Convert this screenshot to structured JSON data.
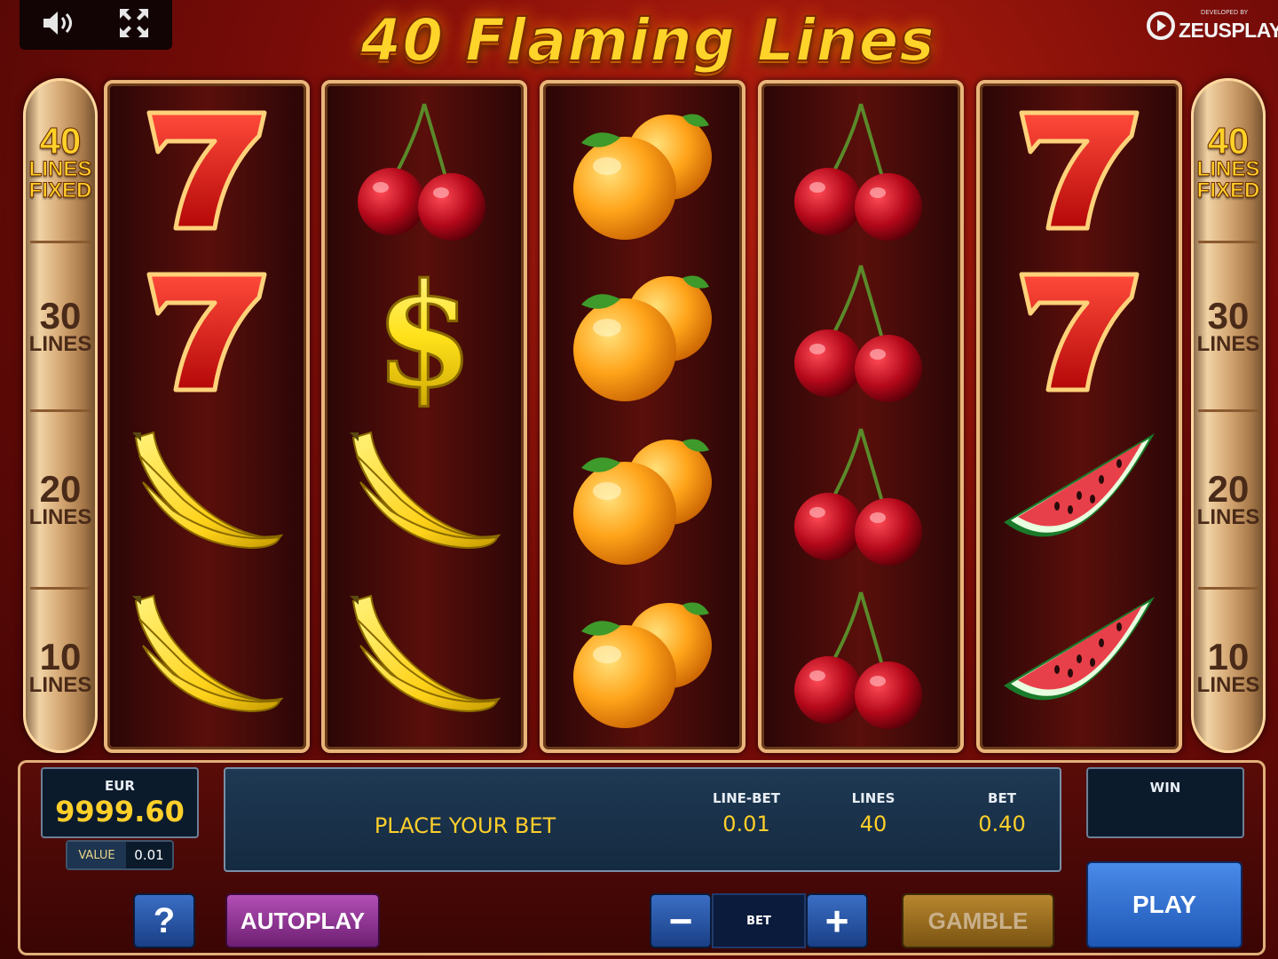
{
  "title": "40 Flaming Lines",
  "developer": {
    "by": "DEVELOPED BY",
    "name": "ZEUSPLAY"
  },
  "top_icons": [
    "speaker-icon",
    "fullscreen-icon"
  ],
  "side_lines": [
    {
      "num": "40",
      "word1": "LINES",
      "word2": "FIXED",
      "active": true
    },
    {
      "num": "30",
      "word1": "LINES"
    },
    {
      "num": "20",
      "word1": "LINES"
    },
    {
      "num": "10",
      "word1": "LINES"
    }
  ],
  "reels": [
    [
      "seven",
      "seven",
      "banana",
      "banana"
    ],
    [
      "cherry",
      "dollar",
      "banana",
      "banana"
    ],
    [
      "orange",
      "orange",
      "orange",
      "orange"
    ],
    [
      "cherry",
      "cherry",
      "cherry",
      "cherry"
    ],
    [
      "seven",
      "seven",
      "watermelon",
      "watermelon"
    ]
  ],
  "balance": {
    "currency": "EUR",
    "amount": "9999.60",
    "value_label": "VALUE",
    "value": "0.01"
  },
  "info": {
    "message": "PLACE YOUR BET",
    "line_bet_label": "LINE-BET",
    "line_bet": "0.01",
    "lines_label": "LINES",
    "lines": "40",
    "bet_label": "BET",
    "bet": "0.40"
  },
  "win": {
    "label": "WIN",
    "value": ""
  },
  "buttons": {
    "help": "?",
    "autoplay": "AUTOPLAY",
    "bet_minus": "−",
    "bet_label": "BET",
    "bet_plus": "+",
    "gamble": "GAMBLE",
    "play": "PLAY"
  },
  "colors": {
    "accent_yellow": "#ffcf2a",
    "panel_blue": "#0b1b2c",
    "play_blue": "#2a6fd0",
    "autoplay_purple": "#8a2d8f",
    "gamble_gold": "#9a6a20"
  }
}
